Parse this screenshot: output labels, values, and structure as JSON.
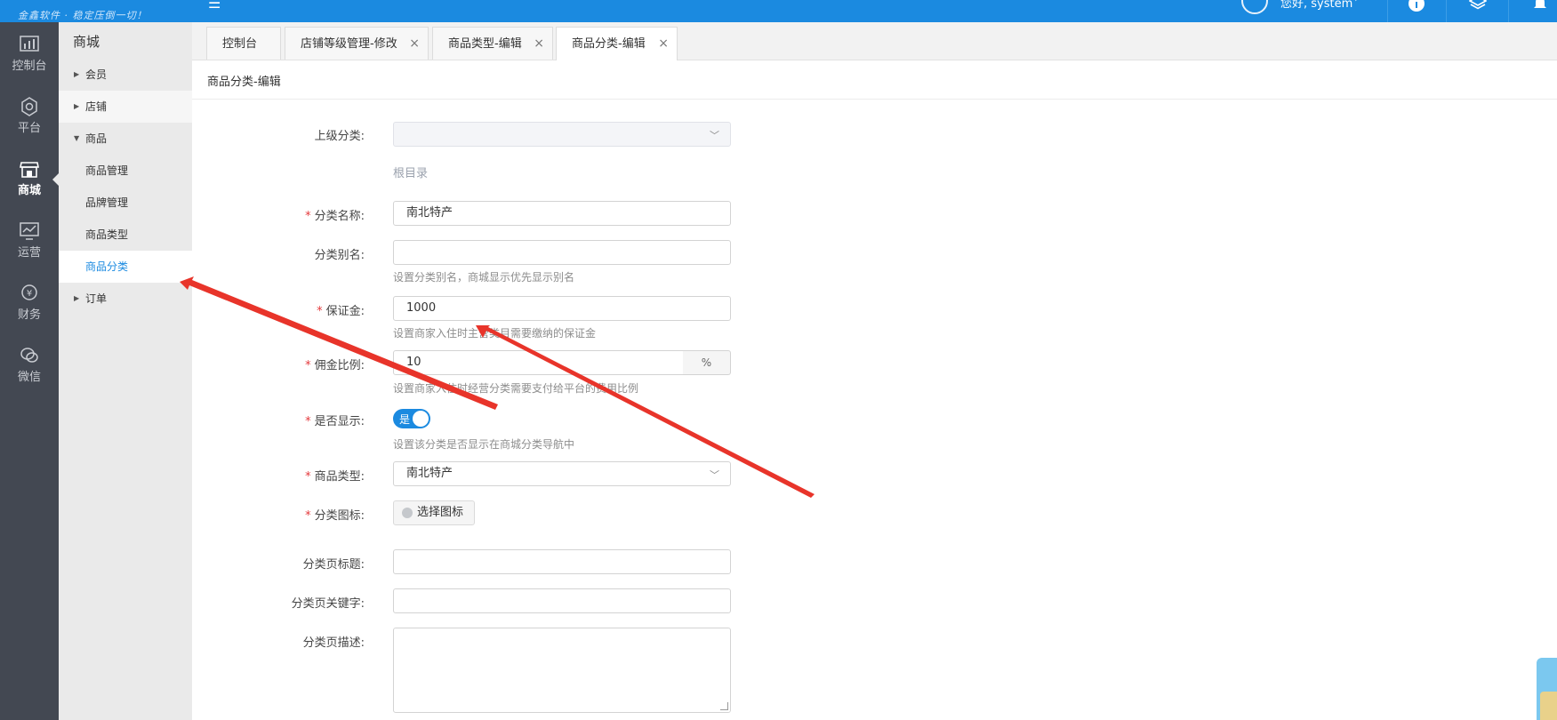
{
  "header": {
    "slogan": "金鑫软件 · 稳定压倒一切！",
    "user_greeting": "您好, system",
    "menu_icon": "menu-icon",
    "icons": [
      "user-avatar-icon",
      "info-icon",
      "layers-icon",
      "bell-icon"
    ]
  },
  "icon_nav": {
    "items": [
      {
        "label": "控制台",
        "icon": "dashboard-icon"
      },
      {
        "label": "平台",
        "icon": "gear-icon"
      },
      {
        "label": "商城",
        "icon": "store-icon",
        "active": true
      },
      {
        "label": "运营",
        "icon": "monitor-chart-icon"
      },
      {
        "label": "财务",
        "icon": "finance-icon"
      },
      {
        "label": "微信",
        "icon": "wechat-icon"
      }
    ]
  },
  "submenu": {
    "title": "商城",
    "items": [
      {
        "label": "会员",
        "type": "group",
        "expanded": false
      },
      {
        "label": "店铺",
        "type": "group",
        "expanded": false
      },
      {
        "label": "商品",
        "type": "group",
        "expanded": true
      },
      {
        "label": "商品管理",
        "type": "child"
      },
      {
        "label": "品牌管理",
        "type": "child"
      },
      {
        "label": "商品类型",
        "type": "child"
      },
      {
        "label": "商品分类",
        "type": "child",
        "current": true
      },
      {
        "label": "订单",
        "type": "group",
        "expanded": false
      }
    ]
  },
  "tabs": [
    {
      "label": "控制台",
      "closable": false
    },
    {
      "label": "店铺等级管理-修改",
      "closable": true
    },
    {
      "label": "商品类型-编辑",
      "closable": true
    },
    {
      "label": "商品分类-编辑",
      "closable": true,
      "active": true
    }
  ],
  "close_symbol": "×",
  "breadcrumb": "商品分类-编辑",
  "form": {
    "parent_category": {
      "label": "上级分类:",
      "value": "",
      "root_text": "根目录"
    },
    "name": {
      "label": "分类名称:",
      "required": true,
      "value": "南北特产"
    },
    "alias": {
      "label": "分类别名:",
      "value": "",
      "hint": "设置分类别名，商城显示优先显示别名"
    },
    "deposit": {
      "label": "保证金:",
      "required": true,
      "value": "1000",
      "hint": "设置商家入住时主营类目需要缴纳的保证金"
    },
    "commission": {
      "label": "佣金比例:",
      "required": true,
      "value": "10",
      "unit": "%",
      "hint": "设置商家入住时经营分类需要支付给平台的费用比例"
    },
    "show": {
      "label": "是否显示:",
      "required": true,
      "on_text": "是",
      "checked": true,
      "hint": "设置该分类是否显示在商城分类导航中"
    },
    "goods_type": {
      "label": "商品类型:",
      "required": true,
      "value": "南北特产"
    },
    "icon": {
      "label": "分类图标:",
      "required": true,
      "button": "选择图标"
    },
    "page_title": {
      "label": "分类页标题:",
      "value": ""
    },
    "page_keywords": {
      "label": "分类页关键字:",
      "value": ""
    },
    "page_description": {
      "label": "分类页描述:",
      "value": ""
    }
  },
  "required_mark": "*",
  "annotation_color": "#e8342a",
  "accent_color": "#1b8ae0"
}
